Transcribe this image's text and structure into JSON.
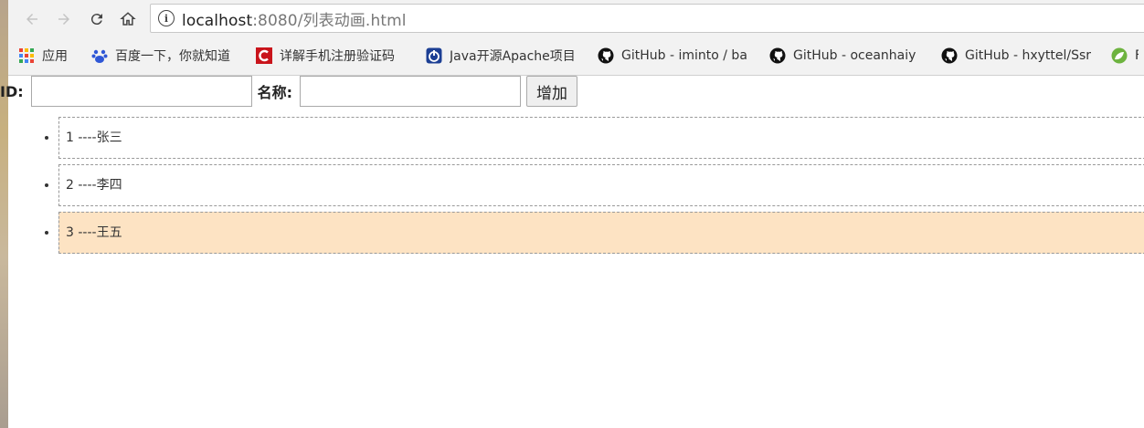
{
  "browser": {
    "url_host": "localhost",
    "url_path": ":8080/列表动画.html",
    "bookmarks": [
      {
        "label": "应用",
        "icon": "apps-grid-icon"
      },
      {
        "label": "百度一下，你就知道",
        "icon": "baidu-paw-icon"
      },
      {
        "label": "详解手机注册验证码",
        "icon": "csdn-c-icon"
      },
      {
        "label": "Java开源Apache项目",
        "icon": "bookmark-blue-icon"
      },
      {
        "label": "GitHub - iminto / ba",
        "icon": "github-icon"
      },
      {
        "label": "GitHub - oceanhaiy",
        "icon": "github-icon"
      },
      {
        "label": "GitHub - hxyttel/Ssr",
        "icon": "github-icon"
      },
      {
        "label": "F",
        "icon": "spring-leaf-icon"
      }
    ]
  },
  "form": {
    "id_label": "ID:",
    "id_value": "",
    "name_label": "名称:",
    "name_value": "",
    "add_button": "增加"
  },
  "list": {
    "items": [
      {
        "text": "1 ----张三",
        "highlighted": false
      },
      {
        "text": "2 ----李四",
        "highlighted": false
      },
      {
        "text": "3 ----王五",
        "highlighted": true
      }
    ],
    "highlight_color": "#fde3c3"
  }
}
